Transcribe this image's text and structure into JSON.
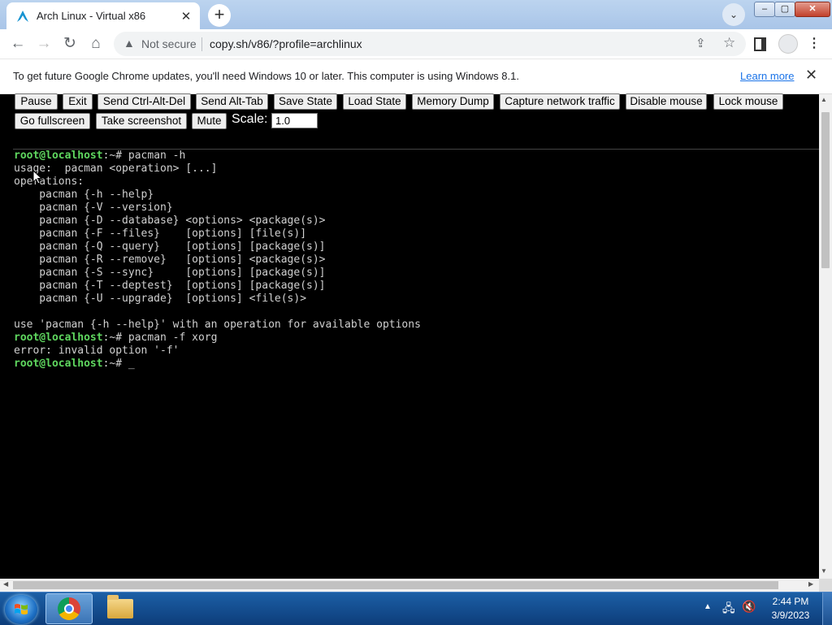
{
  "browser": {
    "tab_title": "Arch Linux - Virtual x86",
    "tab_close": "✕",
    "new_tab": "+",
    "not_secure": "Not secure",
    "url": "copy.sh/v86/?profile=archlinux",
    "infobar_text": "To get future Google Chrome updates, you'll need Windows 10 or later. This computer is using Windows 8.1.",
    "infobar_link": "Learn more",
    "infobar_close": "✕"
  },
  "controls": {
    "row1": [
      "Pause",
      "Exit",
      "Send Ctrl-Alt-Del",
      "Send Alt-Tab",
      "Save State",
      "Load State",
      "Memory Dump",
      "Capture network traffic",
      "Disable mouse",
      "Lock mouse"
    ],
    "row2": [
      "Go fullscreen",
      "Take screenshot",
      "Mute"
    ],
    "scale_label": "Scale:",
    "scale_value": "1.0"
  },
  "terminal": {
    "prompt": "root@localhost",
    "lines": [
      {
        "type": "prompt",
        "cmd": "pacman -h"
      },
      {
        "type": "out",
        "text": "usage:  pacman <operation> [...]"
      },
      {
        "type": "out",
        "text": "operations:"
      },
      {
        "type": "out",
        "text": "    pacman {-h --help}"
      },
      {
        "type": "out",
        "text": "    pacman {-V --version}"
      },
      {
        "type": "out",
        "text": "    pacman {-D --database} <options> <package(s)>"
      },
      {
        "type": "out",
        "text": "    pacman {-F --files}    [options] [file(s)]"
      },
      {
        "type": "out",
        "text": "    pacman {-Q --query}    [options] [package(s)]"
      },
      {
        "type": "out",
        "text": "    pacman {-R --remove}   [options] <package(s)>"
      },
      {
        "type": "out",
        "text": "    pacman {-S --sync}     [options] [package(s)]"
      },
      {
        "type": "out",
        "text": "    pacman {-T --deptest}  [options] [package(s)]"
      },
      {
        "type": "out",
        "text": "    pacman {-U --upgrade}  [options] <file(s)>"
      },
      {
        "type": "out",
        "text": ""
      },
      {
        "type": "out",
        "text": "use 'pacman {-h --help}' with an operation for available options"
      },
      {
        "type": "prompt",
        "cmd": "pacman -f xorg"
      },
      {
        "type": "out",
        "text": "error: invalid option '-f'"
      },
      {
        "type": "prompt",
        "cmd": "",
        "cursor": true
      }
    ]
  },
  "taskbar": {
    "time": "2:44 PM",
    "date": "3/9/2023"
  },
  "colors": {
    "prompt": "#5fd75f",
    "terminal_text": "#d0d0d0",
    "taskbar": "#1c5fa6"
  }
}
